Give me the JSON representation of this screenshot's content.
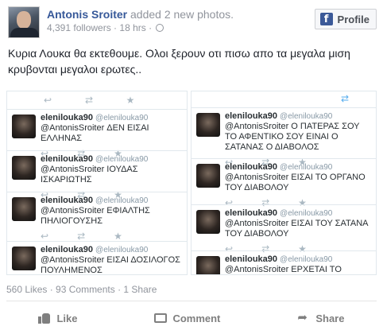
{
  "post": {
    "author": "Antonis Sroiter",
    "action": " added 2 new photos.",
    "followers": "4,391 followers",
    "separator": " · ",
    "time": "18 hrs",
    "time_sep": " · ",
    "text": "Κυρια Λουκα θα εκτεθουμε. Ολοι ξερουν οτι πισω απο τα μεγαλα μιση κρυβονται μεγαλοι ερωτες.."
  },
  "profile_button": {
    "label": "Profile",
    "icon": "f"
  },
  "photos": {
    "left": [
      {
        "user": "elenilouka90",
        "handle": "@elenilouka90",
        "text": "@AntonisSroiter ΔΕΝ ΕΙΣΑΙ ΕΛΛΗΝΑΣ"
      },
      {
        "user": "elenilouka90",
        "handle": "@elenilouka90",
        "text": "@AntonisSroiter ΙΟΥΔΑΣ ΙΣΚΑΡΙΩΤΗΣ"
      },
      {
        "user": "elenilouka90",
        "handle": "@elenilouka90",
        "text": "@AntonisSroiter ΕΦΙΑΛΤΗΣ ΠΗΛΙΟΓΟΥΣΗΣ"
      },
      {
        "user": "elenilouka90",
        "handle": "@elenilouka90",
        "text": "@AntonisSroiter ΕΙΣΑΙ ΔΟΣΙΛΟΓΟΣ ΠΟΥΛΗΜΕΝΟΣ ΠΡΟΣΚΥΝΗΜΕΝΟΣ"
      }
    ],
    "right": [
      {
        "user": "elenilouka90",
        "handle": "@elenilouka90",
        "text": "@AntonisSroiter Ο ΠΑΤΕΡΑΣ ΣΟΥ ΤΟ ΑΦΕΝΤΙΚΟ ΣΟΥ ΕΙΝΑΙ Ο ΣΑΤΑΝΑΣ Ο ΔΙΑΒΟΛΟΣ"
      },
      {
        "user": "elenilouka90",
        "handle": "@elenilouka90",
        "text": "@AntonisSroiter ΕΙΣΑΙ ΤΟ ΟΡΓΑΝΟ ΤΟΥ ΔΙΑΒΟΛΟΥ"
      },
      {
        "user": "elenilouka90",
        "handle": "@elenilouka90",
        "text": "@AntonisSroiter ΕΙΣΑΙ ΤΟΥ ΣΑΤΑΝΑ ΤΟΥ ΔΙΑΒΟΛΟΥ"
      },
      {
        "user": "elenilouka90",
        "handle": "@elenilouka90",
        "text": "@AntonisSroiter ΕΡΧΕΤΑΙ ΤΟ ΤΕΛΟΣ"
      }
    ],
    "tweet_icons": {
      "reply": "↩",
      "retweet": "⇄",
      "favorite": "★"
    }
  },
  "stats": {
    "likes": "560 Likes",
    "sep1": " · ",
    "comments": "93 Comments",
    "sep2": " · ",
    "shares": "1 Share"
  },
  "actions": {
    "like": "Like",
    "comment": "Comment",
    "share": "Share"
  },
  "colors": {
    "link": "#365899",
    "facebook": "#3b5998",
    "twitter": "#55acee",
    "muted": "#90949c"
  }
}
